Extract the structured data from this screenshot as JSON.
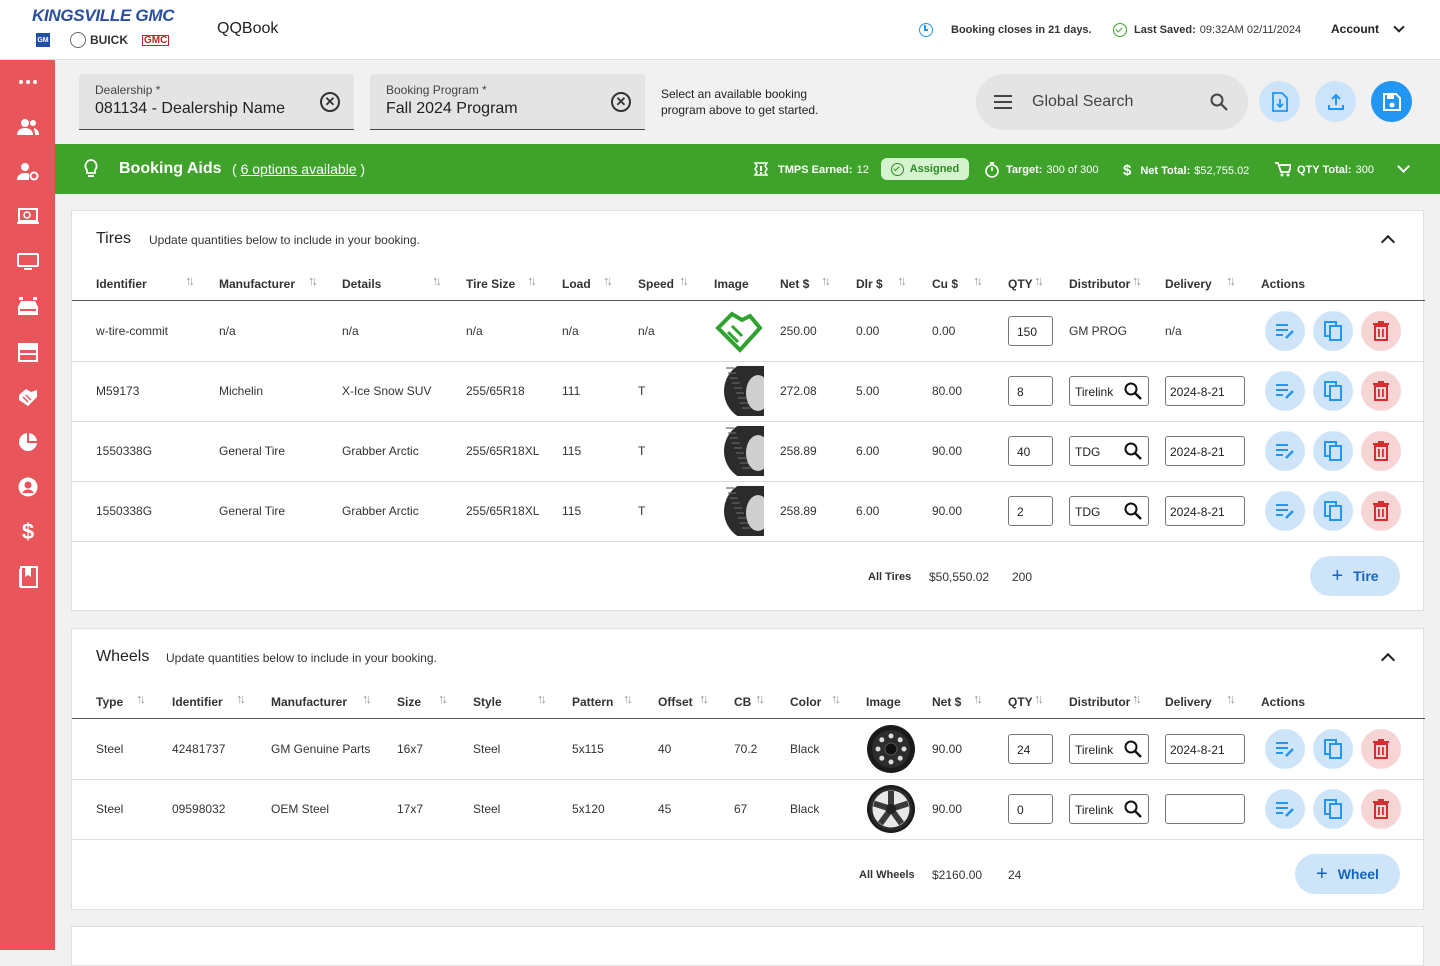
{
  "brand": {
    "name": "KINGSVILLE GMC",
    "buick": "BUICK",
    "gmc": "GMC",
    "gm": "GM"
  },
  "app_title": "QQBook",
  "header": {
    "booking_closes": "Booking closes in 21 days.",
    "last_saved_label": "Last Saved:",
    "last_saved_value": "09:32AM 02/11/2024",
    "account": "Account"
  },
  "filters": {
    "dealership_label": "Dealership *",
    "dealership_value": "081134 - Dealership Name",
    "program_label": "Booking Program *",
    "program_value": "Fall 2024 Program",
    "hint_line1": "Select an available booking",
    "hint_line2": "program above to get started.",
    "search_placeholder": "Global Search"
  },
  "booking_aids": {
    "title": "Booking Aids",
    "options_open": "( ",
    "options_count": "6",
    "options_text": "options available",
    "options_close": " )",
    "tmps_label": "TMPS Earned:",
    "tmps_value": "12",
    "assigned": "Assigned",
    "target_label": "Target:",
    "target_value": "300 of 300",
    "net_label": "Net Total:",
    "net_value": "$52,755.02",
    "qty_label": "QTY Total:",
    "qty_value": "300"
  },
  "tires": {
    "title": "Tires",
    "subtitle": "Update quantities below to include in your booking.",
    "columns": [
      "Identifier",
      "Manufacturer",
      "Details",
      "Tire Size",
      "Load",
      "Speed",
      "Image",
      "Net $",
      "Dlr $",
      "Cu $",
      "QTY",
      "Distributor",
      "Delivery",
      "Actions"
    ],
    "rows": [
      {
        "identifier": "w-tire-commit",
        "manufacturer": "n/a",
        "details": "n/a",
        "size": "n/a",
        "load": "n/a",
        "speed": "n/a",
        "image": "handshake-logo",
        "net": "250.00",
        "dlr": "0.00",
        "cu": "0.00",
        "qty": "150",
        "distributor": "GM PROG",
        "delivery": "n/a"
      },
      {
        "identifier": "M59173",
        "manufacturer": "Michelin",
        "details": "X-Ice Snow SUV",
        "size": "255/65R18",
        "load": "111",
        "speed": "T",
        "image": "tire",
        "net": "272.08",
        "dlr": "5.00",
        "cu": "80.00",
        "qty": "8",
        "distributor": "Tirelink",
        "delivery": "2024-8-21"
      },
      {
        "identifier": "1550338G",
        "manufacturer": "General Tire",
        "details": "Grabber Arctic",
        "size": "255/65R18XL",
        "load": "115",
        "speed": "T",
        "image": "tire",
        "net": "258.89",
        "dlr": "6.00",
        "cu": "90.00",
        "qty": "40",
        "distributor": "TDG",
        "delivery": "2024-8-21"
      },
      {
        "identifier": "1550338G",
        "manufacturer": "General Tire",
        "details": "Grabber Arctic",
        "size": "255/65R18XL",
        "load": "115",
        "speed": "T",
        "image": "tire",
        "net": "258.89",
        "dlr": "6.00",
        "cu": "90.00",
        "qty": "2",
        "distributor": "TDG",
        "delivery": "2024-8-21"
      }
    ],
    "total_label": "All Tires",
    "total_value": "$50,550.02",
    "total_qty": "200",
    "add_label": "Tire"
  },
  "wheels": {
    "title": "Wheels",
    "subtitle": "Update quantities below to include in your booking.",
    "columns": [
      "Type",
      "Identifier",
      "Manufacturer",
      "Size",
      "Style",
      "Pattern",
      "Offset",
      "CB",
      "Color",
      "Image",
      "Net $",
      "QTY",
      "Distributor",
      "Delivery",
      "Actions"
    ],
    "rows": [
      {
        "type": "Steel",
        "identifier": "42481737",
        "manufacturer": "GM Genuine Parts",
        "size": "16x7",
        "style": "Steel",
        "pattern": "5x115",
        "offset": "40",
        "cb": "70.2",
        "color": "Black",
        "image": "steel-wheel",
        "net": "90.00",
        "qty": "24",
        "distributor": "Tirelink",
        "delivery": "2024-8-21"
      },
      {
        "type": "Steel",
        "identifier": "09598032",
        "manufacturer": "OEM Steel",
        "size": "17x7",
        "style": "Steel",
        "pattern": "5x120",
        "offset": "45",
        "cb": "67",
        "color": "Black",
        "image": "alloy-wheel",
        "net": "90.00",
        "qty": "0",
        "distributor": "Tirelink",
        "delivery": ""
      }
    ],
    "total_label": "All Wheels",
    "total_value": "$2160.00",
    "total_qty": "24",
    "add_label": "Wheel"
  },
  "colors": {
    "sidebar": "#e8555b",
    "green_bar": "#3fa32b",
    "primary_blue": "#2196f3",
    "delete_red": "#d32f2f"
  }
}
